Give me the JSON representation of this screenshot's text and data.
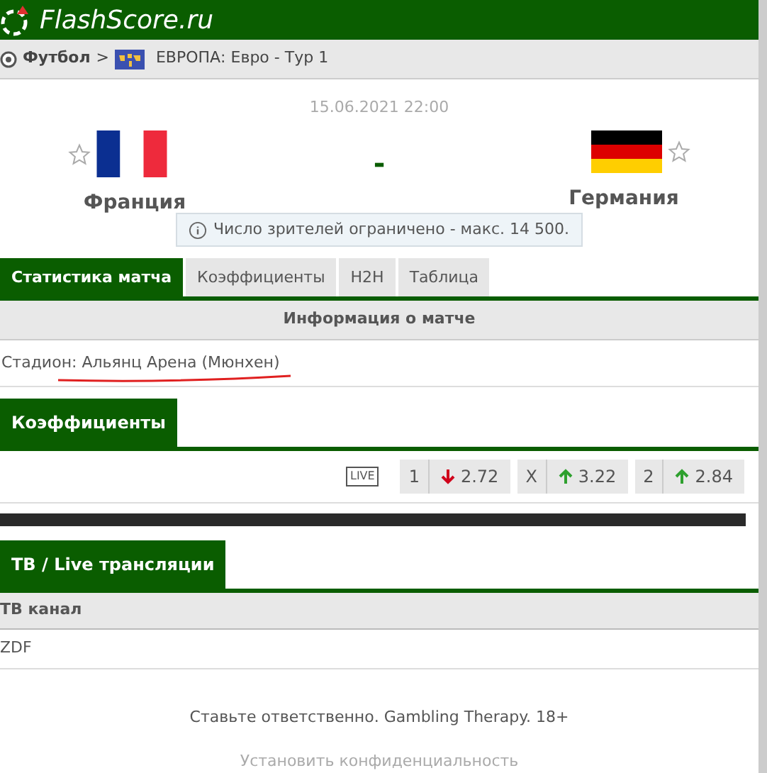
{
  "header": {
    "logo": "FlashScore.ru"
  },
  "breadcrumb": {
    "sport": "Футбол",
    "separator": ">",
    "league": "ЕВРОПА: Евро - Тур 1"
  },
  "match": {
    "datetime": "15.06.2021 22:00",
    "score": "-",
    "home": {
      "name": "Франция",
      "favorite": false
    },
    "away": {
      "name": "Германия",
      "favorite": false
    },
    "notice": "Число зрителей ограничено - макс. 14 500."
  },
  "tabs": [
    {
      "label": "Статистика матча",
      "selected": true
    },
    {
      "label": "Коэффициенты",
      "selected": false
    },
    {
      "label": "H2H",
      "selected": false
    },
    {
      "label": "Таблица",
      "selected": false
    }
  ],
  "info": {
    "heading": "Информация о матче",
    "stadium": "Стадион: Альянц Арена (Мюнхен)"
  },
  "odds": {
    "heading": "Коэффициенты",
    "live": "LIVE",
    "items": [
      {
        "label": "1",
        "value": "2.72",
        "kind": "down"
      },
      {
        "label": "X",
        "value": "3.22",
        "kind": "up"
      },
      {
        "label": "2",
        "value": "2.84",
        "kind": "up"
      }
    ]
  },
  "tv": {
    "heading": "ТВ / Live трансляции",
    "column": "ТВ канал",
    "channels": [
      "ZDF"
    ]
  },
  "footer": {
    "notice": "Ставьте ответственно. Gambling Therapy. 18+",
    "privacy": "Установить конфиденциальность"
  }
}
